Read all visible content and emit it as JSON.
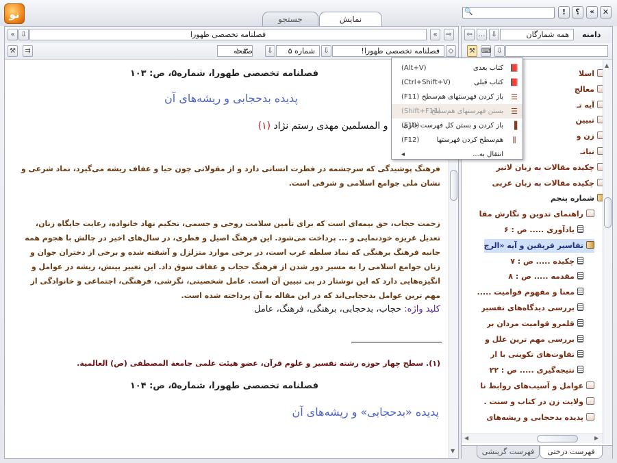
{
  "tabs": {
    "display": "نمایش",
    "search": "جستجو"
  },
  "window": {
    "help": "؟",
    "alert": "!",
    "close": "✕",
    "back": "«"
  },
  "left_toolbar": {
    "title_field": "فصلنامه تخصصی طهورا",
    "book_field": "فصلنامه تخصصی طهورا!",
    "issue_field": "شماره ۵",
    "page_label": "صفحه",
    "page_value": "۱۰۳"
  },
  "document": {
    "header1": "فصلنامه تخصصی طهورا، شماره۵، ص: ۱۰۳",
    "title1": "پدیده بدحجابی و ریشه‌های آن",
    "author": "حجت‌الاسلام و المسلمین مهدی رستم نژاد",
    "author_ref": "(۱)",
    "para1": "فرهنگ پوشیدگی که سرچشمه در فطرت انسانی دارد و از مقولاتی چون حیا و عفاف ریشه می‌گیرد، نماد شرعی و نشان ملی جوامع اسلامی و شرقی است.",
    "para2": "زحمت حجاب، حق بیمه‌ای است که برای تأمین سلامت روحی و جسمی، تحکیم نهاد خانواده، رعایت جایگاه زنان، تعدیل غریزه خودنمایی و ... پرداخت می‌شود. این فرهنگ اصیل و فطری، در سال‌های اخیر در چالش با هجوم همه جانبه فرهنگ برهنگی که نماد سلطه غرب است، در برخی موارد متزلزل و آشفته شده و برخی از دختران جوان و زنان جوامع اسلامی را به مسیر دور شدن از فرهنگ حجاب و عفاف سوق داد. این تغییر بینش، ریشه در عوامل و انگیزه‌هایی دارد که این نوشتار در پی تبیین آن است. عامل شخصیتی، نگرشی، فرهنگی، اجتماعی و خانوادگی از مهم ترین عوامل بدحجابی‌اند که در این مقاله به آن پرداخته شده است.",
    "keywords_label": "کلید واژه:",
    "keywords": "حجاب، بدحجابی، برهنگی، فرهنگ، عامل",
    "footnote": "(۱). سطح چهار حوزه رشته تفسیر و علوم قرآن، عضو هیئت علمی جامعة المصطفی (ص) العالمیة.",
    "header2": "فصلنامه تخصصی طهورا، شماره۵، ص: ۱۰۴",
    "title2": "پدیده «بدحجابی» و ریشه‌های آن"
  },
  "menu": [
    {
      "label": "کتاب بعدی",
      "key": "(Alt+V)",
      "icon": "book-next-icon",
      "disabled": false
    },
    {
      "label": "کتاب قبلی",
      "key": "(Ctrl+Shift+V)",
      "icon": "book-prev-icon",
      "disabled": false
    },
    {
      "label": "باز کردن فهرستهای هم‌سطح",
      "key": "(F11)",
      "icon": "expand-icon",
      "disabled": false
    },
    {
      "label": "بستن فهرستهای هم‌سطح",
      "key": "(Shift+F11)",
      "icon": "collapse-icon",
      "disabled": true
    },
    {
      "label": "باز کردن و بستن کل فهرست جاری",
      "key": "(F10)",
      "icon": "toggle-icon",
      "disabled": false
    },
    {
      "label": "هم‌سطح کردن فهرستها",
      "key": "(F12)",
      "icon": "level-icon",
      "disabled": false
    },
    {
      "label": "انتقال به...",
      "key": "◂",
      "icon": "",
      "disabled": false
    }
  ],
  "right_toolbar": {
    "domain_label": "دامنه",
    "domain_value": "همه شمارگان"
  },
  "tree": [
    {
      "text": "اسلا",
      "type": "art",
      "indent": 0
    },
    {
      "text": "معالج",
      "type": "art",
      "indent": 0
    },
    {
      "text": "آیه تـ",
      "type": "art",
      "indent": 0
    },
    {
      "text": "تبیین",
      "type": "art",
      "indent": 0
    },
    {
      "text": "زن و",
      "type": "art",
      "indent": 0
    },
    {
      "text": "نباتـ",
      "type": "art",
      "indent": 0
    },
    {
      "text": "چکیده مقالات به زبان لاتیر",
      "type": "art",
      "indent": 0
    },
    {
      "text": "چکیده مقالات به زبان عربی",
      "type": "art",
      "indent": 0
    },
    {
      "text": "شماره پنجم",
      "type": "sec",
      "indent": 0
    },
    {
      "text": "راهنمای تدوین و نگارش مقا",
      "type": "art",
      "indent": 1
    },
    {
      "text": "یادآوری ..... ص : ۶",
      "type": "doc",
      "indent": 2
    },
    {
      "text": "تفاسیر فریقین و آیه «الرج",
      "type": "sel",
      "indent": 1
    },
    {
      "text": "چکیده ..... ص : ۷",
      "type": "doc",
      "indent": 2
    },
    {
      "text": "مقدمه ..... ص : ۸",
      "type": "doc",
      "indent": 2
    },
    {
      "text": "معنا و مفهوم قوامیت .....",
      "type": "doc",
      "indent": 2
    },
    {
      "text": "بررسی دیدگاه‌های تفسیر",
      "type": "doc",
      "indent": 2
    },
    {
      "text": "قلمرو قوامیت مردان بر",
      "type": "doc",
      "indent": 2
    },
    {
      "text": "بررسی مهم ترین علل و",
      "type": "doc",
      "indent": 2
    },
    {
      "text": "تفاوت‌های تکوینی با ار",
      "type": "doc",
      "indent": 2
    },
    {
      "text": "نتیجه‌گیری ..... ص : ۲۲",
      "type": "doc",
      "indent": 2
    },
    {
      "text": "عوامل و آسیب‌های روابط نا",
      "type": "art",
      "indent": 1
    },
    {
      "text": "ولایت زن در کتاب و سنت .",
      "type": "art",
      "indent": 1
    },
    {
      "text": "پدیده بدحجابی و ریشه‌های",
      "type": "art",
      "indent": 1
    }
  ],
  "bottom_tabs": {
    "tree": "فهرست درختی",
    "selective": "فهرست گزینشی"
  },
  "colors": {
    "accent": "#4a62c8",
    "body_text": "#6b3b12",
    "ref": "#c02020",
    "selection": "#cfe0f8"
  }
}
